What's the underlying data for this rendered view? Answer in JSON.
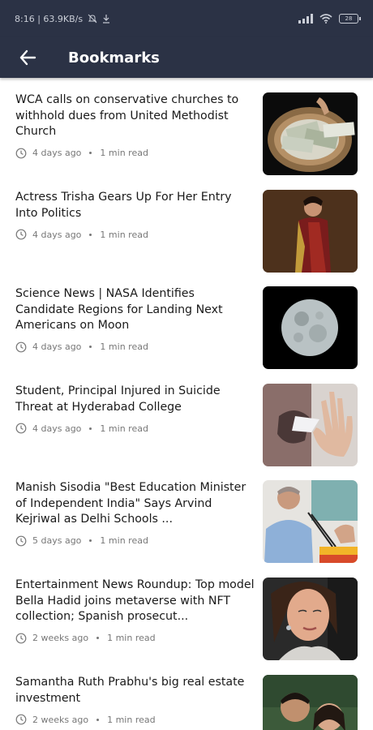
{
  "status_bar": {
    "time_speed": "8:16 | 63.9KB/s",
    "battery": "28"
  },
  "header": {
    "title": "Bookmarks",
    "back_icon": "arrow-left-icon"
  },
  "articles": [
    {
      "title": "WCA calls on conservative churches to withhold dues from United Methodist Church",
      "age": "4 days ago",
      "read_time": "1 min read",
      "thumbnail": "money-basket-image"
    },
    {
      "title": "Actress Trisha Gears Up For Her Entry Into Politics",
      "age": "4 days ago",
      "read_time": "1 min read",
      "thumbnail": "actress-portrait-image"
    },
    {
      "title": "Science News | NASA Identifies Candidate Regions for Landing Next Americans on Moon",
      "age": "4 days ago",
      "read_time": "1 min read",
      "thumbnail": "moon-image"
    },
    {
      "title": "Student, Principal Injured in Suicide Threat at Hyderabad College",
      "age": "4 days ago",
      "read_time": "1 min read",
      "thumbnail": "raised-hand-image"
    },
    {
      "title": "Manish Sisodia \"Best Education Minister of Independent India\" Says Arvind Kejriwal as Delhi Schools ...",
      "age": "5 days ago",
      "read_time": "1 min read",
      "thumbnail": "politician-speech-image"
    },
    {
      "title": "Entertainment News Roundup: Top model Bella Hadid joins metaverse with NFT collection; Spanish prosecut...",
      "age": "2 weeks ago",
      "read_time": "1 min read",
      "thumbnail": "model-portrait-image"
    },
    {
      "title": "Samantha Ruth Prabhu's big real estate investment",
      "age": "2 weeks ago",
      "read_time": "1 min read",
      "thumbnail": "couple-selfie-image"
    }
  ]
}
